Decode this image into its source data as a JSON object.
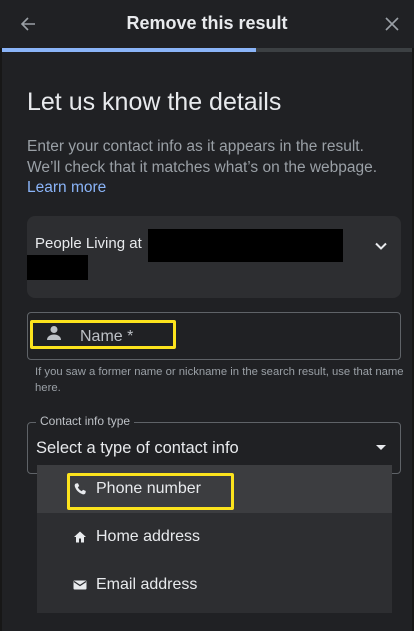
{
  "header": {
    "title": "Remove this result",
    "progress_fraction": 0.62
  },
  "heading": "Let us know the details",
  "intro": {
    "text": "Enter your contact info as it appears in the result. We’ll check that it matches what’s on the webpage.",
    "link": "Learn more"
  },
  "people_card": {
    "label": "People Living at"
  },
  "name_field": {
    "label": "Name *",
    "help": "If you saw a former name or nickname in the search result, use that name here."
  },
  "contact_field": {
    "legend": "Contact info type",
    "value": "Select a type of contact info"
  },
  "menu": {
    "items": [
      {
        "label": "Phone number",
        "icon": "phone-icon"
      },
      {
        "label": "Home address",
        "icon": "home-icon"
      },
      {
        "label": "Email address",
        "icon": "email-icon"
      }
    ]
  },
  "colors": {
    "background": "#202124",
    "accent": "#8ab4f8",
    "highlight": "#fce31d"
  }
}
